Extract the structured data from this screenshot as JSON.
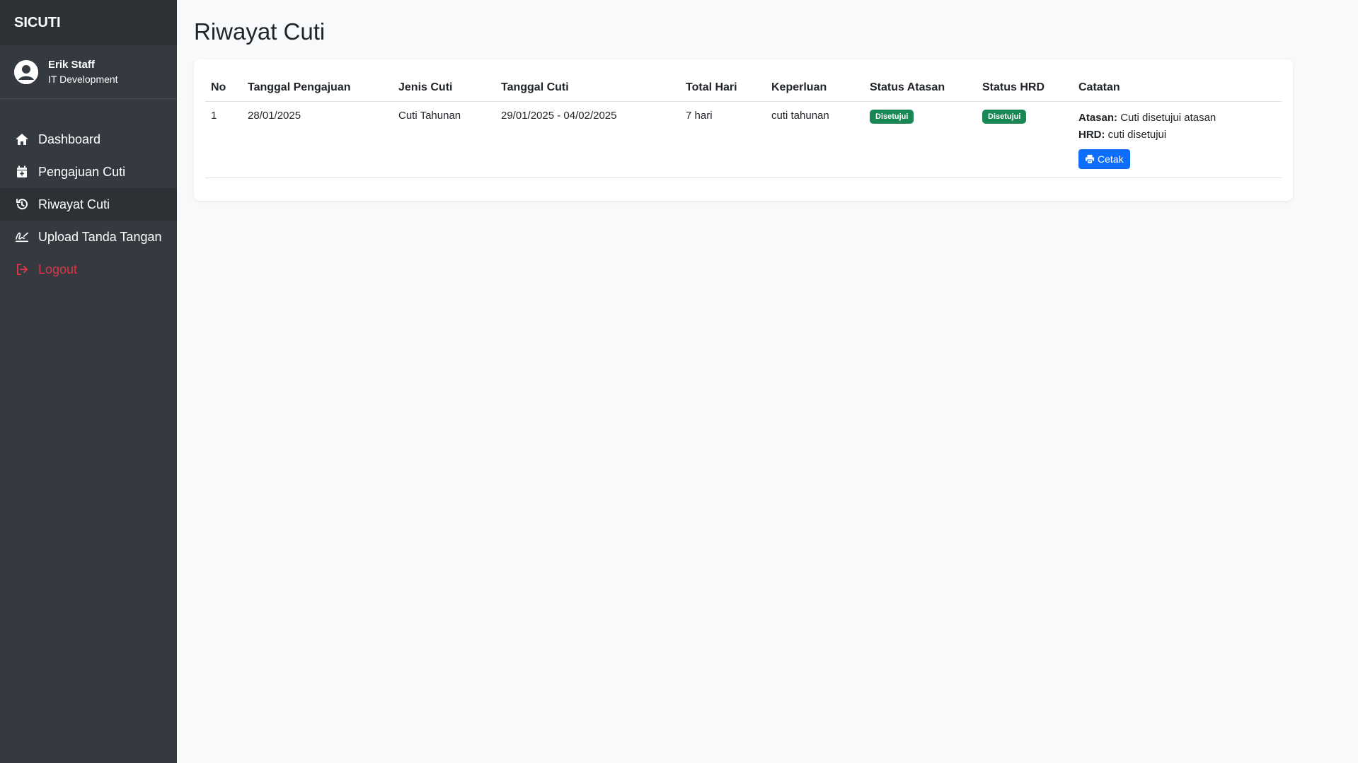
{
  "app": {
    "brand": "SICUTI"
  },
  "user": {
    "name": "Erik Staff",
    "department": "IT Development"
  },
  "sidebar": {
    "items": [
      {
        "label": "Dashboard",
        "icon": "home-icon"
      },
      {
        "label": "Pengajuan Cuti",
        "icon": "calendar-plus-icon"
      },
      {
        "label": "Riwayat Cuti",
        "icon": "history-icon",
        "active": true
      },
      {
        "label": "Upload Tanda Tangan",
        "icon": "signature-icon"
      },
      {
        "label": "Logout",
        "icon": "sign-out-icon"
      }
    ]
  },
  "page": {
    "title": "Riwayat Cuti"
  },
  "table": {
    "headers": [
      "No",
      "Tanggal Pengajuan",
      "Jenis Cuti",
      "Tanggal Cuti",
      "Total Hari",
      "Keperluan",
      "Status Atasan",
      "Status HRD",
      "Catatan"
    ],
    "rows": [
      {
        "no": "1",
        "tanggal_pengajuan": "28/01/2025",
        "jenis_cuti": "Cuti Tahunan",
        "tanggal_cuti": "29/01/2025 - 04/02/2025",
        "total_hari": "7 hari",
        "keperluan": "cuti tahunan",
        "status_atasan": "Disetujui",
        "status_hrd": "Disetujui",
        "catatan_atasan_label": "Atasan:",
        "catatan_atasan": "Cuti disetujui atasan",
        "catatan_hrd_label": "HRD:",
        "catatan_hrd": "cuti disetujui",
        "print_label": "Cetak"
      }
    ]
  },
  "colors": {
    "sidebar_bg": "#343a40",
    "sidebar_active": "#2c3136",
    "logout": "#dc3545",
    "badge_success": "#198754",
    "primary": "#0d6efd"
  }
}
